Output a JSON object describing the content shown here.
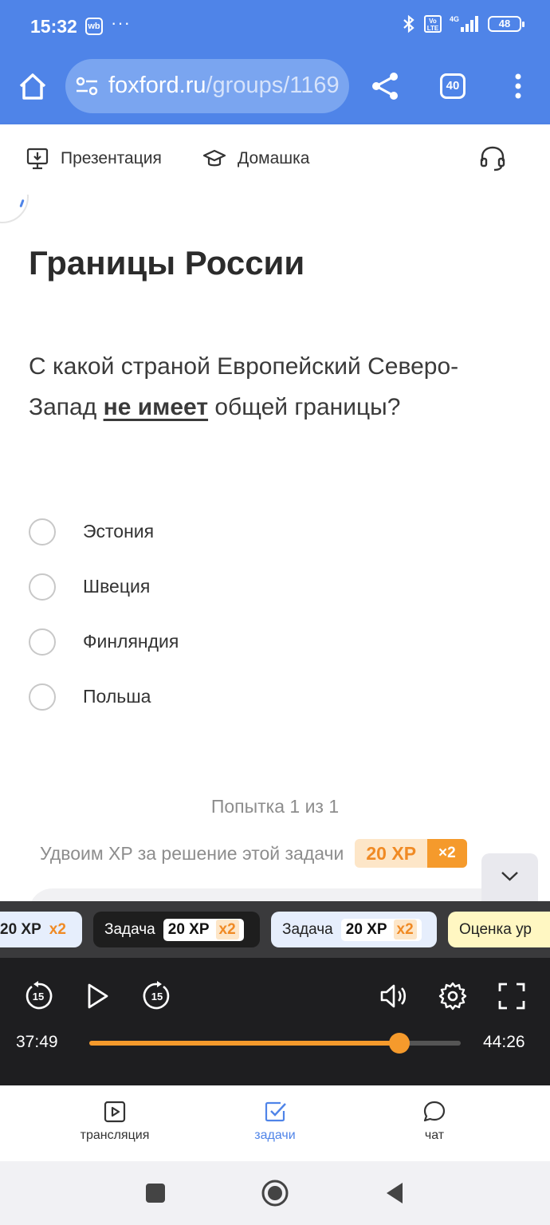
{
  "status_bar": {
    "time": "15:32",
    "wb_badge": "wb",
    "more": "···",
    "network": "4G",
    "volte": "Vo LTE",
    "battery": "48"
  },
  "browser": {
    "url_domain": "foxford.ru",
    "url_path": "/groups/1169",
    "tabs_count": "40",
    "accent_color": "#4f84e8"
  },
  "toolbar": {
    "presentation_label": "Презентация",
    "homework_label": "Домашка"
  },
  "task": {
    "topic": "Границы России",
    "question_before": "С какой страной Европейский Северо-Запад ",
    "question_emphasis": "не имеет",
    "question_after": " общей границы?",
    "options": [
      "Эстония",
      "Швеция",
      "Финляндия",
      "Польша"
    ],
    "attempt": "Попытка 1 из 1",
    "double_xp_label": "Удвоим XP за решение этой задачи",
    "xp": "20 XP",
    "multiplier": "×2"
  },
  "task_strip": {
    "chips": [
      {
        "label": "",
        "xp": "20 XP",
        "mult": "x2"
      },
      {
        "label": "Задача",
        "xp": "20 XP",
        "mult": "x2"
      },
      {
        "label": "Задача",
        "xp": "20 XP",
        "mult": "x2"
      },
      {
        "label": "Оценка ур",
        "xp": "",
        "mult": ""
      }
    ]
  },
  "player": {
    "current_time": "37:49",
    "total_time": "44:26",
    "progress": 0.835,
    "skip_seconds": "15"
  },
  "bottom_nav": {
    "items": [
      {
        "label": "трансляция",
        "icon": "play-square-icon",
        "active": false
      },
      {
        "label": "задачи",
        "icon": "check-square-icon",
        "active": true
      },
      {
        "label": "чат",
        "icon": "chat-bubble-icon",
        "active": false
      }
    ]
  }
}
